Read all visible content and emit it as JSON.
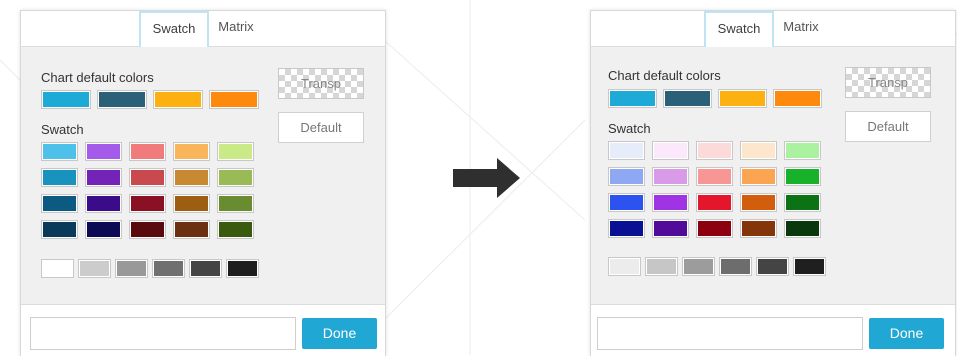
{
  "tabs": {
    "swatch": "Swatch",
    "matrix": "Matrix"
  },
  "labels": {
    "chart_default_colors": "Chart default colors",
    "swatch": "Swatch"
  },
  "buttons": {
    "transparent": "Transp",
    "default": "Default",
    "done": "Done"
  },
  "color_input": {
    "value": ""
  },
  "icons": {
    "transition_arrow": "arrow-right-icon"
  },
  "before": {
    "default_colors": [
      "#1eaad7",
      "#2a6178",
      "#fcb110",
      "#fd8a0d"
    ],
    "swatch_rows": [
      [
        "#4ec1ea",
        "#a55be9",
        "#f17b7b",
        "#f8b55b",
        "#caea88"
      ],
      [
        "#1793bd",
        "#7423b9",
        "#c94a4e",
        "#c98933",
        "#99bb56"
      ],
      [
        "#0c5a82",
        "#3a0c8a",
        "#8a1024",
        "#9c5e10",
        "#6a8c30"
      ],
      [
        "#093a5a",
        "#0c0a55",
        "#5a0a0d",
        "#6a3010",
        "#3a5a0e"
      ]
    ],
    "gray_row": [
      "#ffffff",
      "#cccccc",
      "#999999",
      "#707070",
      "#444444",
      "#1e1e1e"
    ]
  },
  "after": {
    "default_colors": [
      "#1eaad7",
      "#2a6178",
      "#fcb110",
      "#fd8a0d"
    ],
    "swatch_rows": [
      [
        "#e6ecfa",
        "#fbe8fb",
        "#fddada",
        "#fde7cc",
        "#abf2a0"
      ],
      [
        "#8fa8f3",
        "#d99be8",
        "#f89696",
        "#fba452",
        "#18b22a"
      ],
      [
        "#2c52f0",
        "#a034e4",
        "#e3162b",
        "#d25d0c",
        "#0b7314"
      ],
      [
        "#0a1094",
        "#520a9a",
        "#8c0010",
        "#84350a",
        "#0a380d"
      ]
    ],
    "gray_row": [
      "#ececec",
      "#c6c6c6",
      "#9c9c9c",
      "#6d6d6d",
      "#444444",
      "#1f1f1f"
    ]
  }
}
